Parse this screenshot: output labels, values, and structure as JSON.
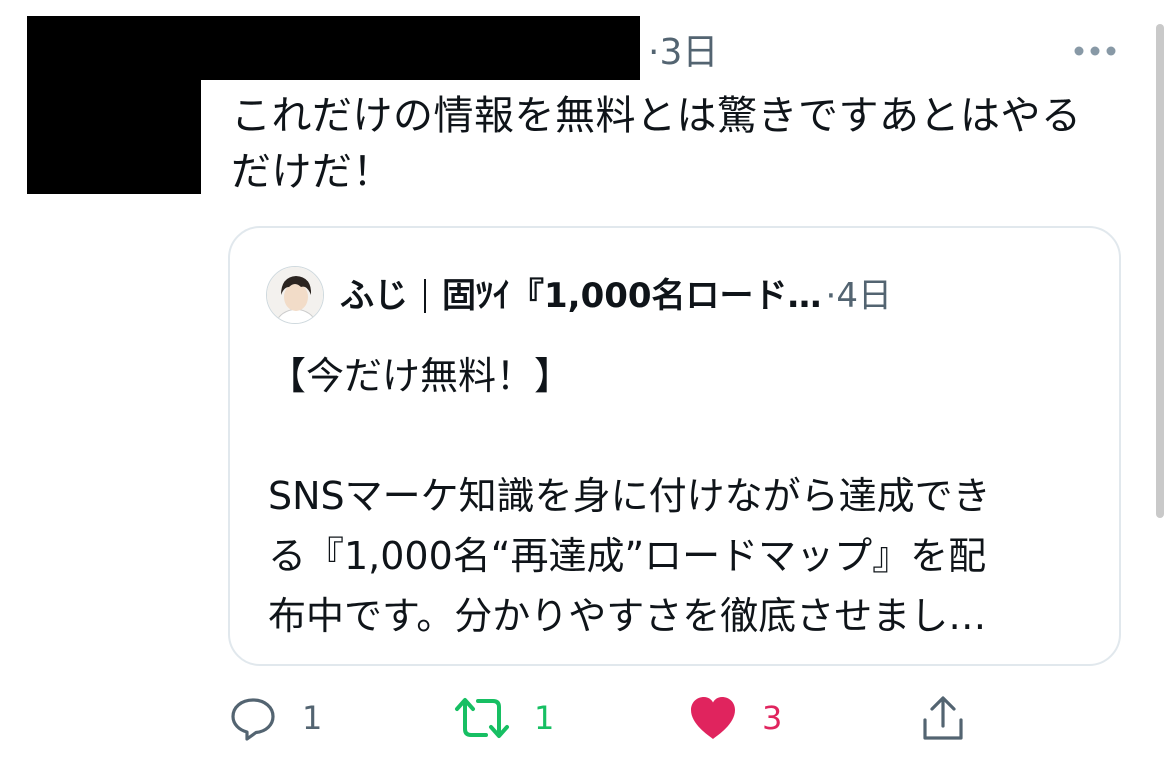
{
  "tweet": {
    "time": "·3日",
    "text": "これだけの情報を無料とは驚きですあとはやる\nだけだ！"
  },
  "quote": {
    "name": "ふじ",
    "handle": "固ﾂｲ『1,000名ロード…",
    "time": "·4日",
    "text": "【今だけ無料！】\n\nSNSマーケ知識を身に付けながら達成でき\nる『1,000名“再達成”ロードマップ』を配\n布中です。分かりやすさを徹底させまし…"
  },
  "actions": {
    "reply_count": "1",
    "retweet_count": "1",
    "like_count": "3"
  },
  "icons": {
    "more": "more-dots-icon",
    "reply": "reply-icon",
    "retweet": "retweet-icon",
    "like": "heart-icon",
    "share": "share-icon"
  },
  "colors": {
    "secondary_text": "#536471",
    "retweet_green": "#17bf63",
    "like_pink": "#e0245e",
    "icon_gray": "#536471",
    "quote_border": "#e1e8ed"
  }
}
